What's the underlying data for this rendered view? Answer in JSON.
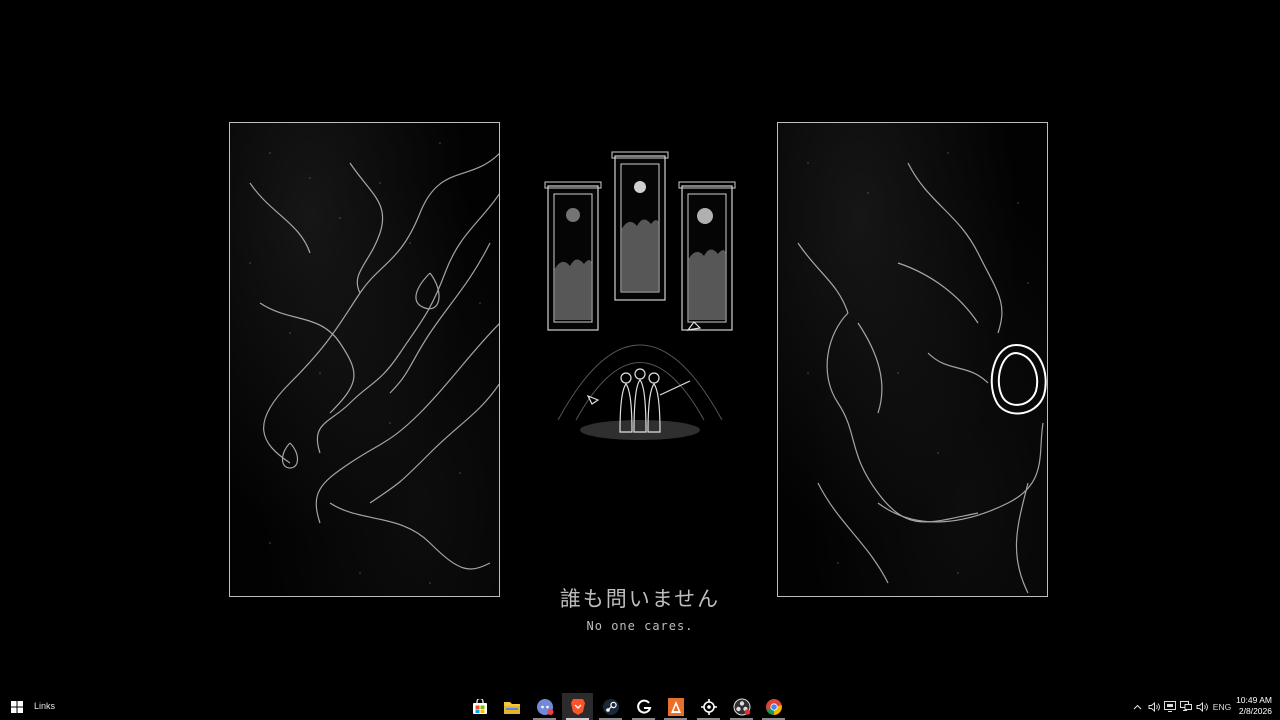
{
  "wallpaper": {
    "caption_japanese": "誰も問いません",
    "caption_english": "No one cares."
  },
  "taskbar": {
    "start_icon": "windows-logo-icon",
    "links_label": "Links",
    "apps": [
      {
        "name": "Microsoft Store",
        "icon": "store-icon",
        "color": "#ffb900"
      },
      {
        "name": "File Explorer",
        "icon": "folder-icon",
        "color": "#f5c542"
      },
      {
        "name": "Discord",
        "icon": "discord-icon",
        "color": "#7289da"
      },
      {
        "name": "Brave",
        "icon": "brave-icon",
        "color": "#fb542b"
      },
      {
        "name": "Steam",
        "icon": "steam-icon",
        "color": "#4a7fb5"
      },
      {
        "name": "Logitech G Hub",
        "icon": "logitech-g-icon",
        "color": "#ffffff"
      },
      {
        "name": "Aseprite",
        "icon": "aseprite-icon",
        "color": "#e8702a"
      },
      {
        "name": "SteelSeries GG",
        "icon": "steelseries-icon",
        "color": "#ffffff"
      },
      {
        "name": "OBS",
        "icon": "obs-icon",
        "color": "#d33"
      },
      {
        "name": "Chrome",
        "icon": "chrome-icon",
        "color": "#34a853"
      }
    ],
    "tray": {
      "overflow_icon": "chevron-up-icon",
      "language": "ENG",
      "time": "10:49 AM",
      "date": "2/8/2026"
    }
  }
}
